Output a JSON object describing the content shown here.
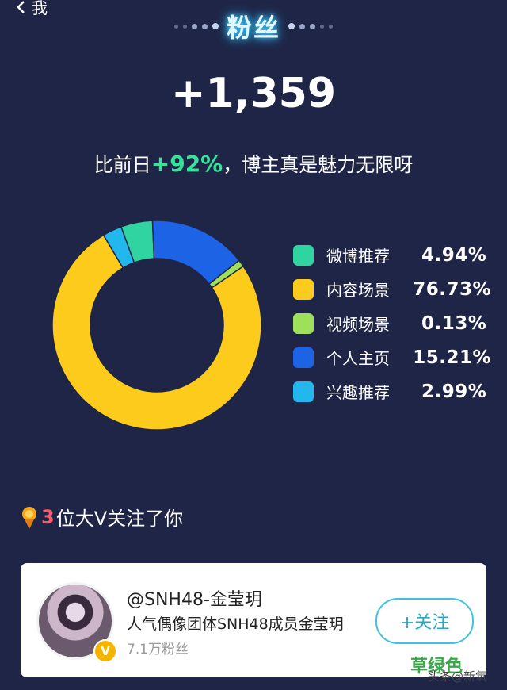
{
  "nav": {
    "back_label": "我"
  },
  "header": {
    "title": "粉丝"
  },
  "summary": {
    "new_fans": "+1,359",
    "compare_prefix": "比前日",
    "compare_pct": "+92%",
    "compare_suffix": "，博主真是魅力无限呀"
  },
  "chart_data": {
    "type": "pie",
    "style": "donut",
    "categories": [
      "微博推荐",
      "内容场景",
      "视频场景",
      "个人主页",
      "兴趣推荐"
    ],
    "values": [
      4.94,
      76.73,
      0.13,
      15.21,
      2.99
    ],
    "value_labels": [
      "4.94%",
      "76.73%",
      "0.13%",
      "15.21%",
      "2.99%"
    ],
    "colors": [
      "#2fd4a0",
      "#fdcb1c",
      "#9fe05a",
      "#1d63e6",
      "#22b8ee"
    ],
    "legend_position": "right"
  },
  "follow": {
    "count": "3",
    "text": "位大V关注了你"
  },
  "card": {
    "name": "@SNH48-金莹玥",
    "description": "人气偶像团体SNH48成员金莹玥",
    "fans": "7.1万粉丝",
    "follow_button": "+关注",
    "verified_mark": "V"
  },
  "watermark": {
    "line1": "草绿色",
    "line2": "头条@新氧"
  }
}
